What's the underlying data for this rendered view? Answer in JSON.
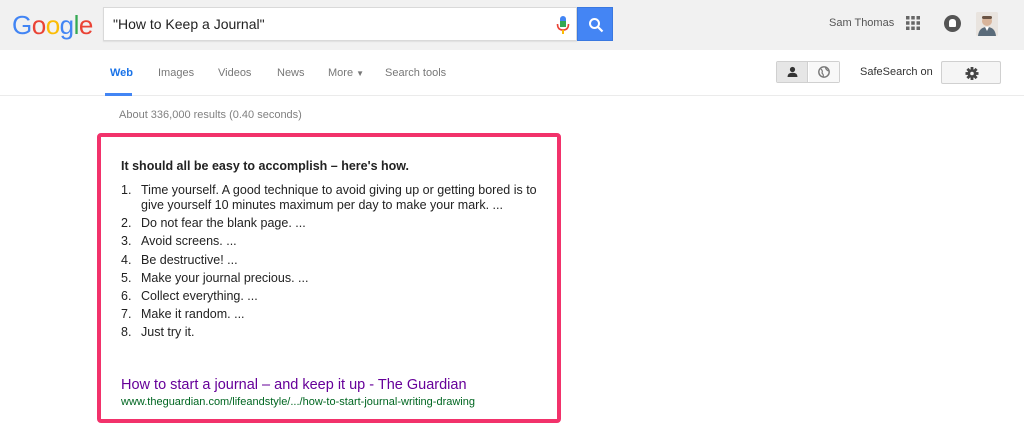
{
  "header": {
    "logo_letters": [
      {
        "ch": "G",
        "color": "#4285f4"
      },
      {
        "ch": "o",
        "color": "#ea4335"
      },
      {
        "ch": "o",
        "color": "#fbbc05"
      },
      {
        "ch": "g",
        "color": "#4285f4"
      },
      {
        "ch": "l",
        "color": "#34a853"
      },
      {
        "ch": "e",
        "color": "#ea4335"
      }
    ],
    "search_query": "\"How to Keep a Journal\"",
    "user_name": "Sam Thomas",
    "icons": {
      "mic": "microphone-icon",
      "search": "search-icon",
      "apps": "apps-grid-icon",
      "notifications": "notifications-icon",
      "avatar": "user-avatar"
    }
  },
  "nav": {
    "tabs": [
      {
        "label": "Web",
        "active": true
      },
      {
        "label": "Images",
        "active": false
      },
      {
        "label": "Videos",
        "active": false
      },
      {
        "label": "News",
        "active": false
      },
      {
        "label": "More",
        "active": false
      },
      {
        "label": "Search tools",
        "active": false
      }
    ],
    "safesearch_label": "SafeSearch on"
  },
  "results": {
    "stats": "About 336,000 results (0.40 seconds)"
  },
  "snippet": {
    "heading": "It should all be easy to accomplish – here's how.",
    "items": [
      {
        "num": "1.",
        "text": "Time yourself. A good technique to avoid giving up or getting bored is to give yourself 10 minutes maximum per day to make your mark. ..."
      },
      {
        "num": "2.",
        "text": "Do not fear the blank page. ..."
      },
      {
        "num": "3.",
        "text": "Avoid screens. ..."
      },
      {
        "num": "4.",
        "text": "Be destructive! ..."
      },
      {
        "num": "5.",
        "text": "Make your journal precious. ..."
      },
      {
        "num": "6.",
        "text": "Collect everything. ..."
      },
      {
        "num": "7.",
        "text": "Make it random. ..."
      },
      {
        "num": "8.",
        "text": "Just try it."
      }
    ],
    "link_title": "How to start a journal – and keep it up - The Guardian",
    "url": "www.theguardian.com/lifeandstyle/.../how-to-start-journal-writing-drawing"
  },
  "colors": {
    "accent_blue": "#4285f4",
    "highlight_border": "#f2326b",
    "visited_link": "#660099",
    "url_green": "#006621"
  }
}
